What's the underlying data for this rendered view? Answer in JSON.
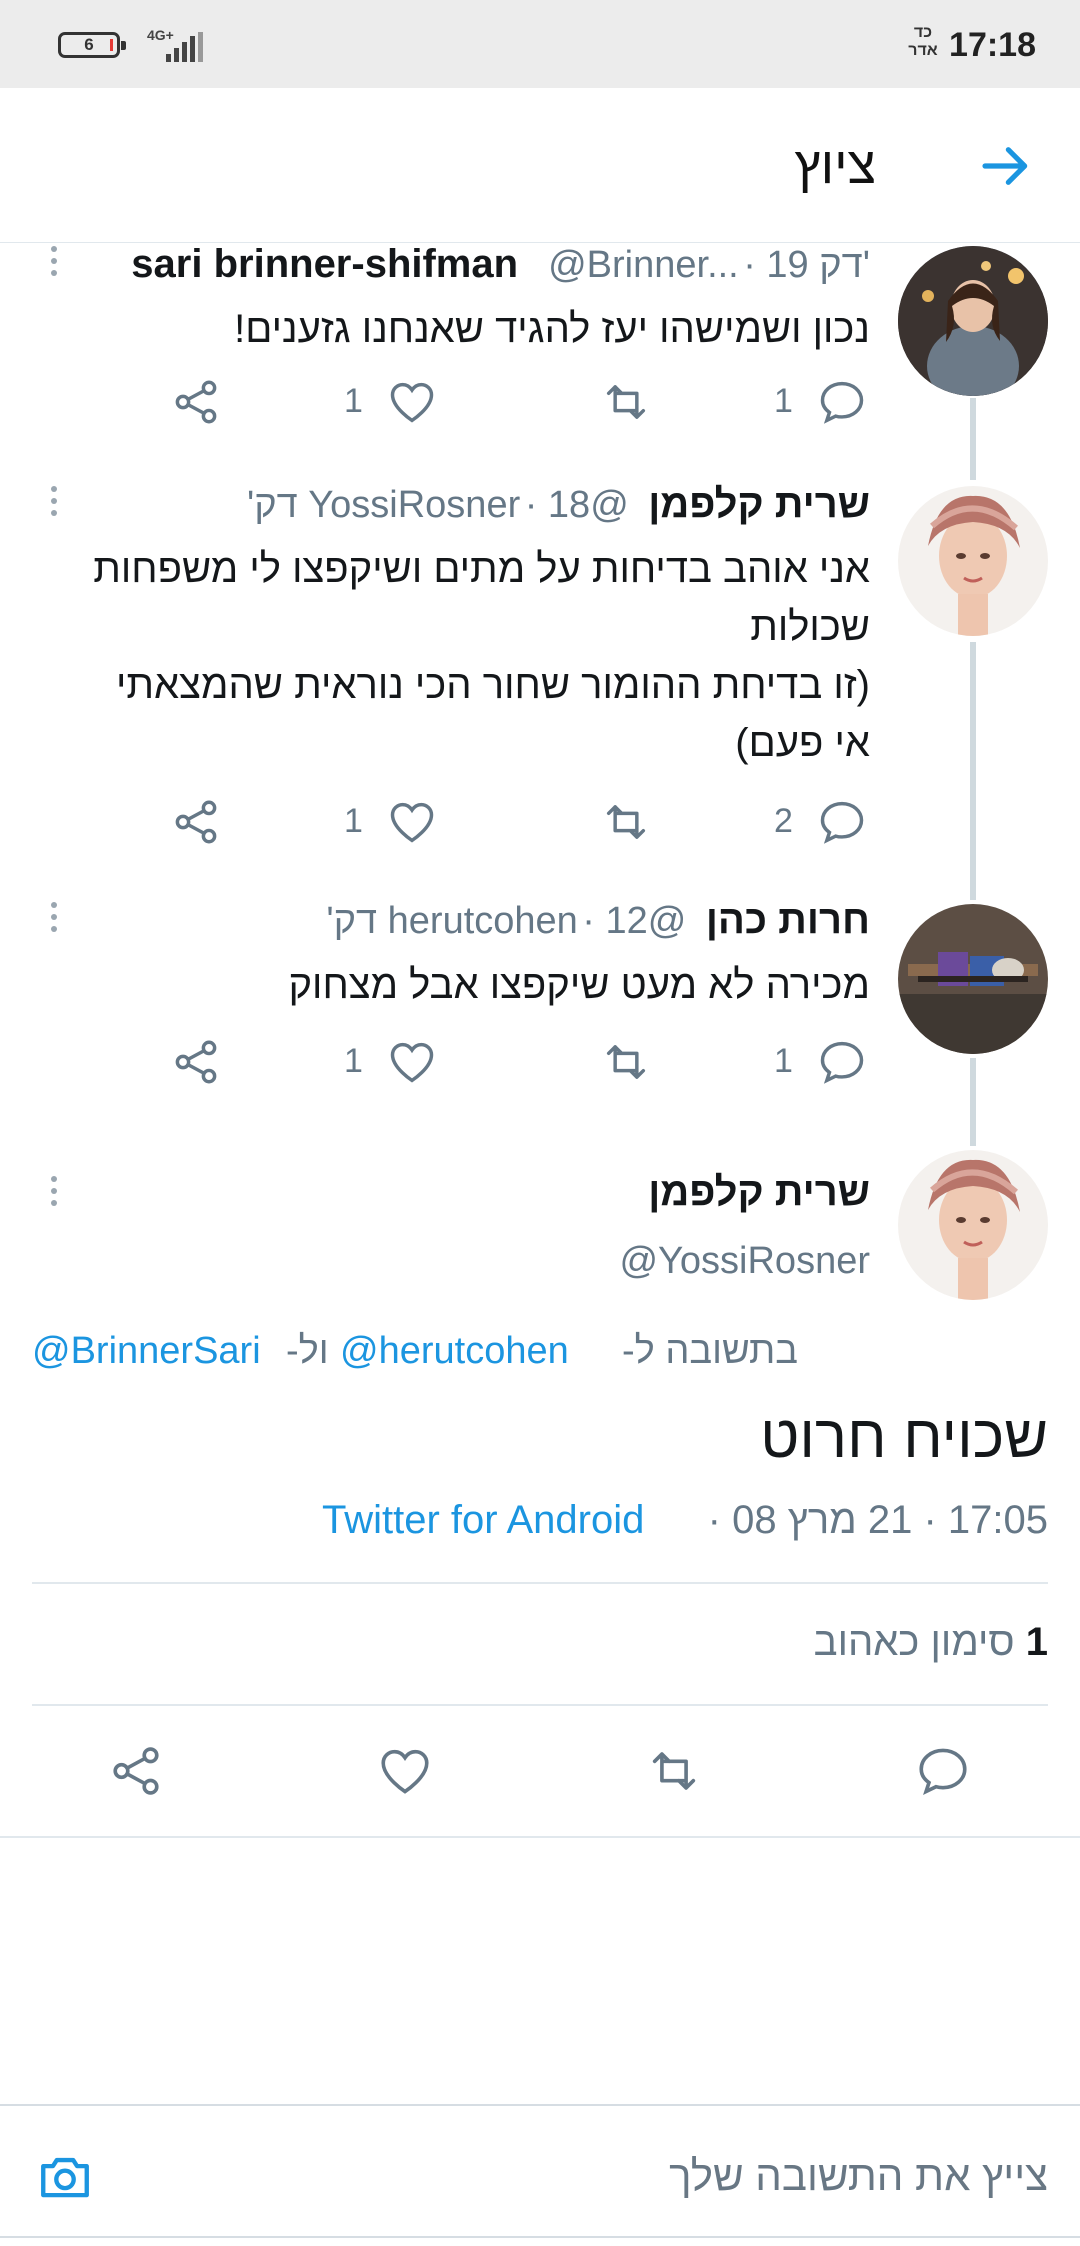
{
  "status_bar": {
    "battery": "6",
    "network": "4G+",
    "time": "17:18",
    "hebrew_date": "כד אדר"
  },
  "header": {
    "title": "ציוץ"
  },
  "thread": [
    {
      "name": "sari brinner-shifman",
      "handle": "@Brinner...",
      "time": "19 דק'",
      "text": "נכון ושמישהו יעז להגיד שאנחנו גזענים!",
      "replies": "1",
      "likes": "1"
    },
    {
      "name": "שרית קלפמן",
      "handle": "@YossiRosner",
      "time": "18 דק'",
      "text": "אני אוהב בדיחות על מתים ושיקפצו לי משפחות\nשכולות\n(זו בדיחת ההומור שחור הכי נוראית שהמצאתי\nאי פעם)",
      "replies": "2",
      "likes": "1"
    },
    {
      "name": "חרות כהן",
      "handle": "@herutcohen",
      "time": "12 דק'",
      "text": "מכירה לא מעט שיקפצו אבל מצחוק",
      "replies": "1",
      "likes": "1"
    }
  ],
  "main_tweet": {
    "name": "שרית קלפמן",
    "handle": "@YossiRosner",
    "reply_prefix": "בתשובה ל-",
    "reply_mention_1": "@herutcohen",
    "reply_joiner": "ול-",
    "reply_mention_2": "@BrinnerSari",
    "text": "שכויח חרוט",
    "timestamp": "17:05 · 21 מרץ 08 · ",
    "source": "Twitter for Android",
    "likes_count": "1",
    "likes_label": "סימון כאהוב"
  },
  "compose": {
    "placeholder": "צייץ את התשובה שלך"
  },
  "icons": {
    "back": "arrow-right-icon",
    "reply": "speech-bubble-icon",
    "retweet": "retweet-icon",
    "like": "heart-icon",
    "share": "share-icon",
    "camera": "camera-icon",
    "more": "more-vertical-icon"
  },
  "colors": {
    "accent": "#1b95e0",
    "muted": "#657786",
    "text": "#14171a"
  }
}
